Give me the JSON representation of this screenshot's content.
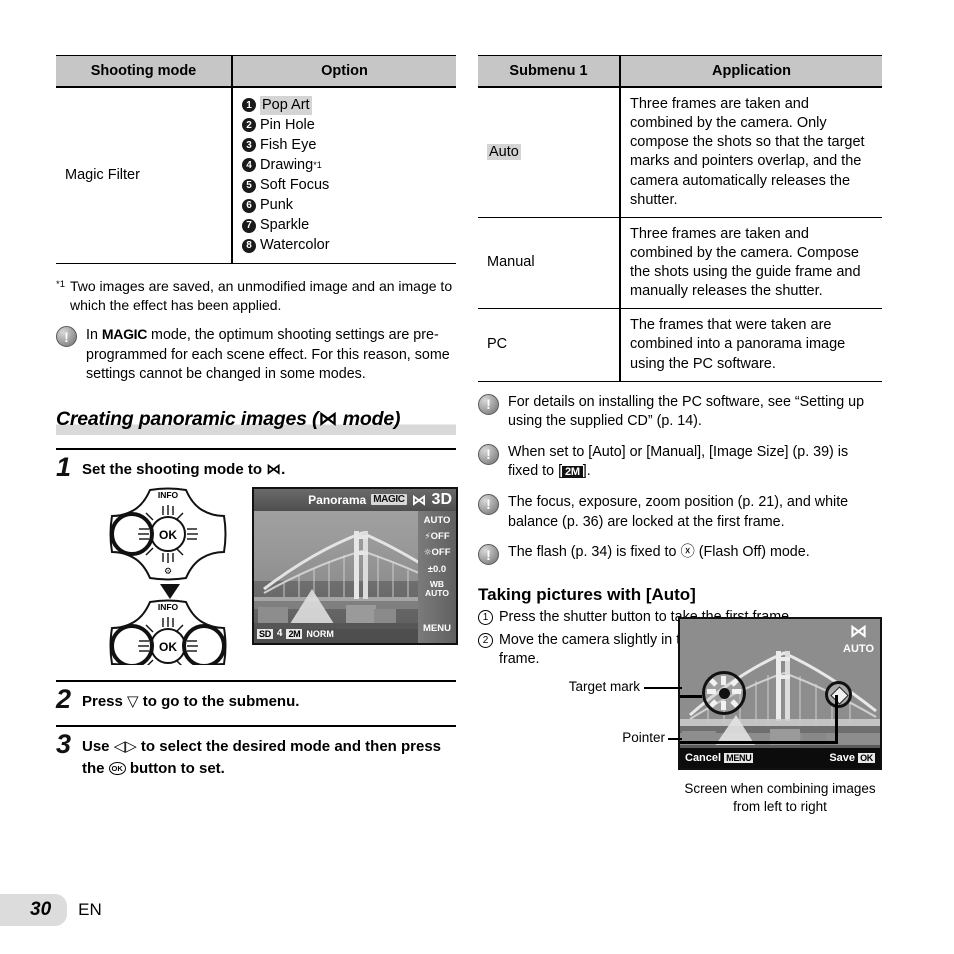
{
  "left_table": {
    "headers": [
      "Shooting mode",
      "Option"
    ],
    "row_label": "Magic Filter",
    "options": [
      {
        "num": "1",
        "label": "Pop Art",
        "highlight": true,
        "footnote": ""
      },
      {
        "num": "2",
        "label": "Pin Hole",
        "highlight": false,
        "footnote": ""
      },
      {
        "num": "3",
        "label": "Fish Eye",
        "highlight": false,
        "footnote": ""
      },
      {
        "num": "4",
        "label": "Drawing",
        "highlight": false,
        "footnote": "*1"
      },
      {
        "num": "5",
        "label": "Soft Focus",
        "highlight": false,
        "footnote": ""
      },
      {
        "num": "6",
        "label": "Punk",
        "highlight": false,
        "footnote": ""
      },
      {
        "num": "7",
        "label": "Sparkle",
        "highlight": false,
        "footnote": ""
      },
      {
        "num": "8",
        "label": "Watercolor",
        "highlight": false,
        "footnote": ""
      }
    ]
  },
  "left_footnote": {
    "mark": "*1",
    "text": "Two images are saved, an unmodified image and an image to which the effect has been applied."
  },
  "left_note": {
    "pre": "In ",
    "magic": "MAGIC",
    "post": " mode, the optimum shooting settings are pre-programmed for each scene effect. For this reason, some settings cannot be changed in some modes."
  },
  "section": {
    "title_pre": "Creating panoramic images (",
    "title_glyph": "⋈",
    "title_post": " mode)"
  },
  "steps": [
    {
      "num": "1",
      "text_pre": "Set the shooting mode to ",
      "glyph": "⋈",
      "text_post": "."
    },
    {
      "num": "2",
      "text_pre": "Press ",
      "glyph": "▽",
      "text_post": " to go to the submenu."
    },
    {
      "num": "3",
      "text_pre": "Use ",
      "glyph": "◁▷",
      "text_post": " to select the desired mode and then press the ",
      "glyph2": "OK",
      "text_post2": " button to set."
    }
  ],
  "dial": {
    "info_label": "INFO",
    "ok_label": "OK",
    "trash_label": "⌂"
  },
  "lcd1": {
    "title": "Panorama",
    "badge_magic": "MAGIC",
    "badge_pano": "⋈",
    "badge_3d": "3D",
    "side": [
      "AUTO",
      "OFF",
      "OFF",
      "±0.0",
      "WB AUTO"
    ],
    "side_menu": "MENU",
    "bottom": [
      "SD",
      "4",
      "2M",
      "NORM"
    ]
  },
  "right_table": {
    "headers": [
      "Submenu 1",
      "Application"
    ],
    "rows": [
      {
        "label": "Auto",
        "highlight": true,
        "text": "Three frames are taken and combined by the camera. Only compose the shots so that the target marks and pointers overlap, and the camera automatically releases the shutter."
      },
      {
        "label": "Manual",
        "highlight": false,
        "text": "Three frames are taken and combined by the camera. Compose the shots using the guide frame and manually releases the shutter."
      },
      {
        "label": "PC",
        "highlight": false,
        "text": "The frames that were taken are combined into a panorama image using the PC software."
      }
    ]
  },
  "right_notes": [
    {
      "text": "For details on installing the PC software, see “Setting up using the supplied CD” (p. 14)."
    },
    {
      "text_pre": "When set to [Auto] or [Manual], [Image Size] (p. 39) is fixed to [",
      "badge": "2M",
      "text_post": "]."
    },
    {
      "text": "The focus, exposure, zoom position (p. 21), and white balance (p. 36) are locked at the first frame."
    },
    {
      "text_pre": "The flash (p. 34) is fixed to ",
      "glyph": "ⓧ",
      "text_post": " (Flash Off) mode."
    }
  ],
  "right_subhead": "Taking pictures with [Auto]",
  "right_olist": [
    {
      "num": "1",
      "text": "Press the shutter button to take the first frame."
    },
    {
      "num": "2",
      "text": "Move the camera slightly in the direction of the second frame."
    }
  ],
  "lcd2": {
    "badge_pano": "⋈",
    "badge_auto": "AUTO",
    "cancel_label": "Cancel",
    "cancel_key": "MENU",
    "save_label": "Save",
    "save_key": "OK"
  },
  "callouts": {
    "target_mark": "Target mark",
    "pointer": "Pointer",
    "caption_line1": "Screen when combining images",
    "caption_line2": "from left to right"
  },
  "footer": {
    "page_number": "30",
    "language": "EN"
  },
  "colors": {
    "header_bg": "#c6c6c6",
    "highlight": "#d4d4d4",
    "page_box": "#dcdcdc"
  }
}
